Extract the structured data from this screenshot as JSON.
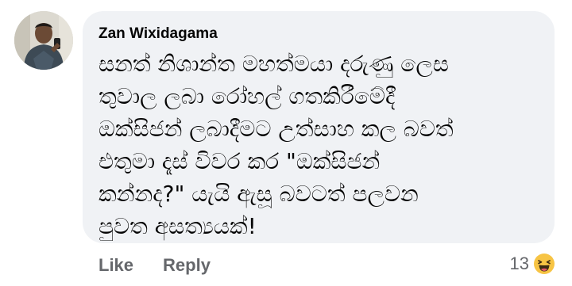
{
  "comment": {
    "author": "Zan Wixidagama",
    "avatar_icon": "profile-photo",
    "text_lines": [
      "සනත් නිශාන්ත මහත්මයා දරුණු ලෙස",
      "තුවාල ලබා රෝහල් ගතකිරීමේදී",
      "ඔක්සිජන් ලබාදීමට උත්සාහ කල බවත්",
      "එතුමා දෑස් විවර කර \"ඔක්සිජන්",
      "කන්නද?\" යැයි ඇසූ බවටත් පලවන",
      "පුවත අසත්‍යයක්!"
    ]
  },
  "actions": {
    "like_label": "Like",
    "reply_label": "Reply"
  },
  "reactions": {
    "count": "13",
    "icon": "haha-icon"
  },
  "colors": {
    "bubble_background": "#f0f2f5",
    "text": "#050505",
    "secondary_text": "#65676b",
    "reaction_yellow": "#f7c444"
  }
}
